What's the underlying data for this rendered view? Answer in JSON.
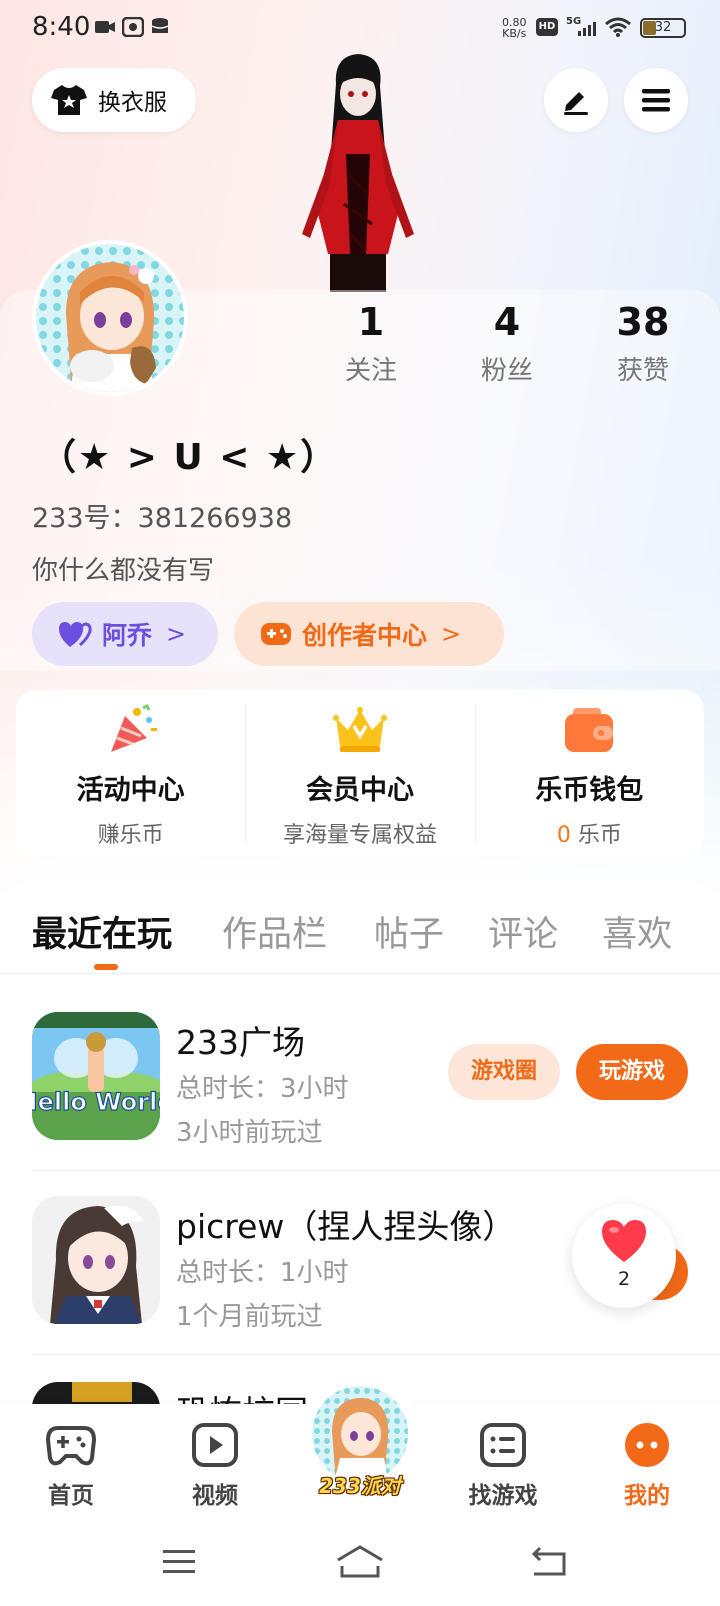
{
  "status_bar": {
    "time": "8:40",
    "net_speed_value": "0.80",
    "net_speed_unit": "KB/s",
    "hd": "HD",
    "signal": "5G",
    "battery": "32"
  },
  "header": {
    "outfit_label": "换衣服"
  },
  "profile": {
    "nickname": "（★ > U < ★）",
    "uid": "233号：381266938",
    "bio": "你什么都没有写",
    "stats": [
      {
        "value": "1",
        "label": "关注"
      },
      {
        "value": "4",
        "label": "粉丝"
      },
      {
        "value": "38",
        "label": "获赞"
      }
    ],
    "tag_purple": "阿乔",
    "tag_orange": "创作者中心"
  },
  "services": [
    {
      "title": "活动中心",
      "subtitle": "赚乐币",
      "icon": "party-popper-icon"
    },
    {
      "title": "会员中心",
      "subtitle": "享海量专属权益",
      "icon": "crown-icon"
    },
    {
      "title": "乐币钱包",
      "coin_count": "0",
      "subtitle": "乐币",
      "icon": "wallet-icon"
    }
  ],
  "tabs": [
    "最近在玩",
    "作品栏",
    "帖子",
    "评论",
    "喜欢"
  ],
  "games": [
    {
      "name": "233广场",
      "total": "总时长：3小时",
      "ago": "3小时前玩过",
      "circle_btn": "游戏圈",
      "play_btn": "玩游戏",
      "icon_text": "Hello World"
    },
    {
      "name": "picrew（捏人捏头像）",
      "total": "总时长：1小时",
      "ago": "1个月前玩过"
    },
    {
      "name": "恐怖校园"
    }
  ],
  "heart_float": {
    "count": "2"
  },
  "bottom_nav": {
    "home": "首页",
    "video": "视频",
    "party": "233派对",
    "find": "找游戏",
    "mine": "我的"
  },
  "colors": {
    "accent": "#f26a17",
    "purple": "#6a4fe0"
  }
}
